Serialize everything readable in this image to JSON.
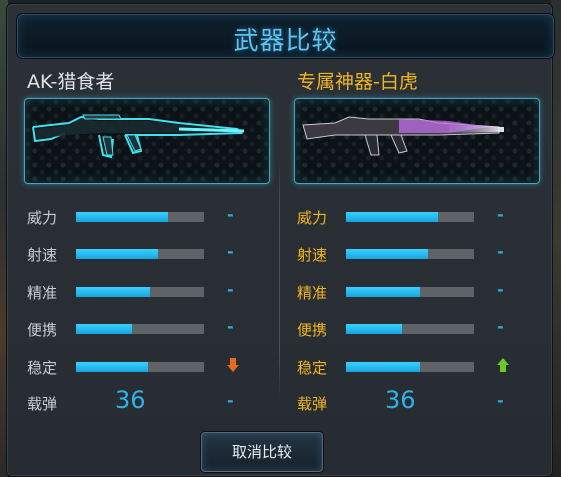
{
  "title": "武器比较",
  "left": {
    "name": "AK-猎食者",
    "stats": [
      {
        "label": "威力",
        "level": 0.72,
        "change": "-"
      },
      {
        "label": "射速",
        "level": 0.64,
        "change": "-"
      },
      {
        "label": "精准",
        "level": 0.58,
        "change": "-"
      },
      {
        "label": "便携",
        "level": 0.44,
        "change": "-"
      },
      {
        "label": "稳定",
        "level": 0.56,
        "change": "down"
      }
    ],
    "ammo": {
      "label": "载弹",
      "value": "36",
      "change": "-"
    }
  },
  "right": {
    "name": "专属神器-白虎",
    "stats": [
      {
        "label": "威力",
        "level": 0.72,
        "change": "-"
      },
      {
        "label": "射速",
        "level": 0.64,
        "change": "-"
      },
      {
        "label": "精准",
        "level": 0.58,
        "change": "-"
      },
      {
        "label": "便携",
        "level": 0.44,
        "change": "-"
      },
      {
        "label": "稳定",
        "level": 0.58,
        "change": "up"
      }
    ],
    "ammo": {
      "label": "载弹",
      "value": "36",
      "change": "-"
    }
  },
  "cancel_button": "取消比较",
  "colors": {
    "accent": "#2fb2ec",
    "highlight": "#f0b522",
    "down": "#e86a1a",
    "up": "#6cc924"
  }
}
